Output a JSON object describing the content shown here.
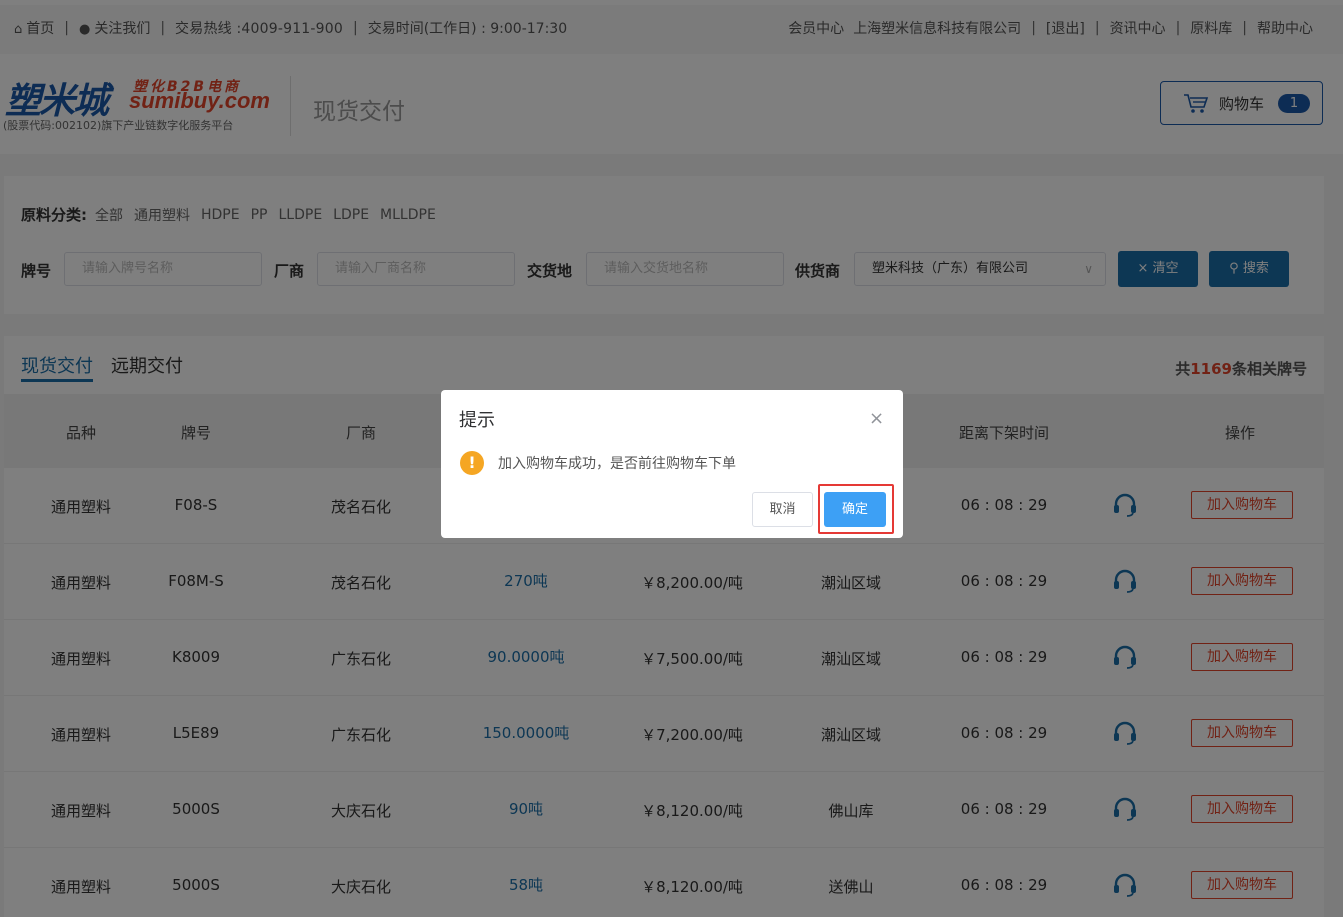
{
  "topbar": {
    "home": "首页",
    "follow": "关注我们",
    "hotline": "交易热线 :4009-911-900",
    "hours": "交易时间(工作日) : 9:00-17:30",
    "member": "会员中心",
    "company": "上海塑米信息科技有限公司",
    "logout": "[退出]",
    "news": "资讯中心",
    "materials": "原料库",
    "help": "帮助中心",
    "separator": "|"
  },
  "header": {
    "logo_cn": "塑米城",
    "logo_tag": "塑化B2B电商",
    "logo_en": "sumibuy.com",
    "logo_sub": "(股票代码:002102)旗下产业链数字化服务平台",
    "section_title": "现货交付",
    "cart_label": "购物车",
    "cart_count": "1"
  },
  "filters": {
    "category_label": "原料分类:",
    "categories": [
      "全部",
      "通用塑料",
      "HDPE",
      "PP",
      "LLDPE",
      "LDPE",
      "MLLDPE"
    ],
    "brand_label": "牌号",
    "brand_placeholder": "请输入牌号名称",
    "maker_label": "厂商",
    "maker_placeholder": "请输入厂商名称",
    "place_label": "交货地",
    "place_placeholder": "请输入交货地名称",
    "supplier_label": "供货商",
    "supplier_value": "塑米科技（广东）有限公司",
    "clear_label": "× 清空",
    "search_label": "搜索"
  },
  "list": {
    "tab_spot": "现货交付",
    "tab_future": "远期交付",
    "count_prefix": "共",
    "count_num": "1169",
    "count_suffix": "条相关牌号",
    "columns": {
      "variety": "品种",
      "brand": "牌号",
      "maker": "厂商",
      "countdown": "距离下架时间",
      "action": "操作"
    },
    "add_label": "加入购物车",
    "rows": [
      {
        "variety": "通用塑料",
        "brand": "F08-S",
        "maker": "茂名石化",
        "qty": "",
        "price": "",
        "place": "",
        "time": "06 : 08 : 29"
      },
      {
        "variety": "通用塑料",
        "brand": "F08M-S",
        "maker": "茂名石化",
        "qty": "270吨",
        "price": "￥8,200.00/吨",
        "place": "潮汕区域",
        "time": "06 : 08 : 29"
      },
      {
        "variety": "通用塑料",
        "brand": "K8009",
        "maker": "广东石化",
        "qty": "90.0000吨",
        "price": "￥7,500.00/吨",
        "place": "潮汕区域",
        "time": "06 : 08 : 29"
      },
      {
        "variety": "通用塑料",
        "brand": "L5E89",
        "maker": "广东石化",
        "qty": "150.0000吨",
        "price": "￥7,200.00/吨",
        "place": "潮汕区域",
        "time": "06 : 08 : 29"
      },
      {
        "variety": "通用塑料",
        "brand": "5000S",
        "maker": "大庆石化",
        "qty": "90吨",
        "price": "￥8,120.00/吨",
        "place": "佛山库",
        "time": "06 : 08 : 29"
      },
      {
        "variety": "通用塑料",
        "brand": "5000S",
        "maker": "大庆石化",
        "qty": "58吨",
        "price": "￥8,120.00/吨",
        "place": "送佛山",
        "time": "06 : 08 : 29"
      }
    ]
  },
  "dialog": {
    "title": "提示",
    "message": "加入购物车成功，是否前往购物车下单",
    "cancel": "取消",
    "confirm": "确定",
    "warn_glyph": "!",
    "close_glyph": "×"
  }
}
